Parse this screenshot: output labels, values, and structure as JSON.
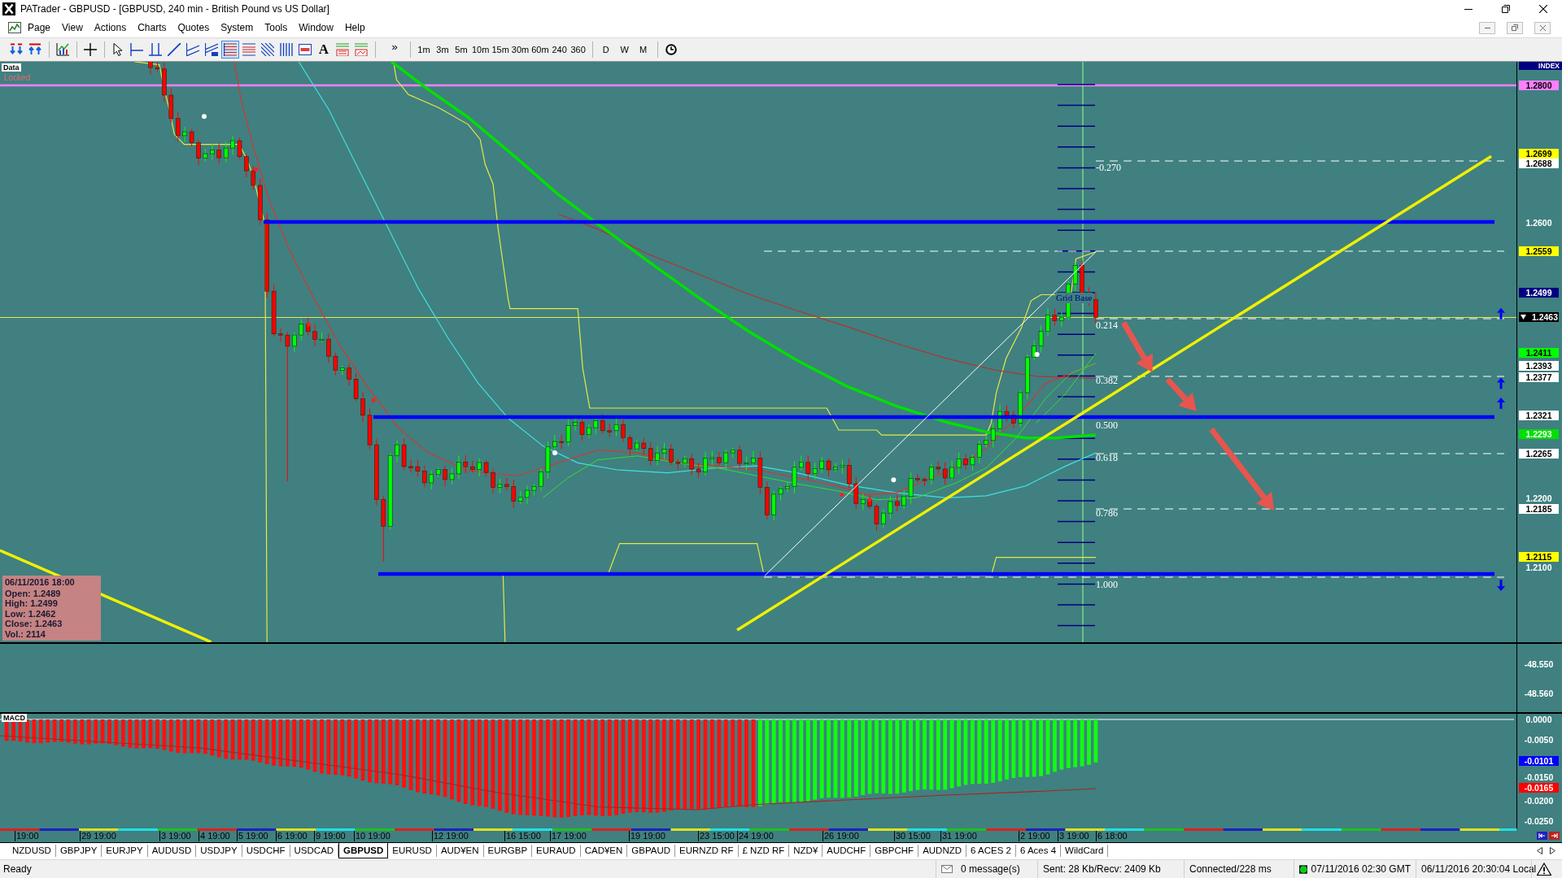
{
  "window": {
    "title": "PATrader - GBPUSD - [GBPUSD, 240 min - British Pound vs US Dollar]"
  },
  "menu": [
    "Page",
    "View",
    "Actions",
    "Charts",
    "Quotes",
    "System",
    "Tools",
    "Window",
    "Help"
  ],
  "toolbar": {
    "tools": [
      {
        "selected": false
      },
      {
        "selected": false
      },
      {
        "selected": false
      },
      {
        "selected": false
      },
      {
        "selected": false
      },
      {
        "selected": false
      },
      {
        "selected": false
      },
      {
        "selected": false
      },
      {
        "selected": false
      },
      {
        "selected": false
      },
      {
        "selected": true
      },
      {
        "selected": false
      },
      {
        "selected": false
      },
      {
        "selected": false
      },
      {
        "selected": false
      },
      {
        "selected": false,
        "label": "A"
      },
      {
        "selected": false
      },
      {
        "selected": false
      }
    ],
    "overflow": "»",
    "timeframes": [
      "1m",
      "3m",
      "5m",
      "10m",
      "15m",
      "30m",
      "60m",
      "240",
      "360"
    ],
    "periods": [
      "D",
      "W",
      "M"
    ]
  },
  "price_pane": {
    "data_tag": "Data",
    "lock_state": "Locked",
    "axis_header": "INDEX",
    "axis_labels": [
      {
        "label": "1.2800",
        "kind": "marker",
        "color": "#ff80ff"
      },
      {
        "label": "1.2699",
        "kind": "marker",
        "color": "#ffff00"
      },
      {
        "label": "1.2688",
        "kind": "marker",
        "color": "#ffffff"
      },
      {
        "label": "1.2600",
        "kind": "tick"
      },
      {
        "label": "1.2559",
        "kind": "marker",
        "color": "#ffff00"
      },
      {
        "label": "1.2499",
        "kind": "marker",
        "color": "#000080"
      },
      {
        "label": "1.2463",
        "kind": "current",
        "color": "#000000"
      },
      {
        "label": "1.2411",
        "kind": "marker",
        "color": "#00ff00"
      },
      {
        "label": "1.2393",
        "kind": "marker",
        "color": "#ffffff"
      },
      {
        "label": "1.2377",
        "kind": "marker",
        "color": "#ffffff"
      },
      {
        "label": "1.2321",
        "kind": "marker",
        "color": "#ffffff"
      },
      {
        "label": "1.2293",
        "kind": "marker",
        "color": "#00e000"
      },
      {
        "label": "1.2265",
        "kind": "marker",
        "color": "#ffffff"
      },
      {
        "label": "1.2200",
        "kind": "tick"
      },
      {
        "label": "1.2185",
        "kind": "marker",
        "color": "#ffffff"
      },
      {
        "label": "1.2115",
        "kind": "marker",
        "color": "#ffff00"
      },
      {
        "label": "1.2100",
        "kind": "tick"
      }
    ],
    "fib_labels": [
      "-0.270",
      "0.214",
      "0.382",
      "0.500",
      "0.618",
      "0.786",
      "1.000"
    ],
    "grid_label": "Grid Base",
    "bar_info": {
      "time": "06/11/2016 18:00",
      "lines": [
        "Open: 1.2489",
        "High: 1.2499",
        "Low: 1.2462",
        "Close: 1.2463",
        "Vol.: 2114"
      ]
    }
  },
  "indicator_pane": {
    "axis_labels": [
      {
        "label": "-48.550",
        "kind": "tick"
      },
      {
        "label": "-48.560",
        "kind": "tick"
      }
    ]
  },
  "macd_pane": {
    "title": "MACD",
    "axis_labels": [
      {
        "label": "0.0000",
        "kind": "tick"
      },
      {
        "label": "-0.0050",
        "kind": "tick"
      },
      {
        "label": "-0.0101",
        "kind": "marker",
        "color": "#0000ff"
      },
      {
        "label": "-0.0150",
        "kind": "tick"
      },
      {
        "label": "-0.0165",
        "kind": "marker",
        "color": "#ff0000"
      },
      {
        "label": "-0.0200",
        "kind": "tick"
      },
      {
        "label": "-0.0250",
        "kind": "tick"
      }
    ]
  },
  "time_axis": {
    "labels": [
      "19:00",
      "29 19:00",
      "3 19:00",
      "4 19:00",
      "5 19:00",
      "6 19:00",
      "9 19:00",
      "10 19:00",
      "12 19:00",
      "16 15:00",
      "17 19:00",
      "19 19:00",
      "23 15:00",
      "24 19:00",
      "26 19:00",
      "30 15:00",
      "31 19:00",
      "2 19:00",
      "3 19:00",
      "6 18:00"
    ]
  },
  "symbol_tabs": [
    {
      "label": "NZDUSD",
      "selected": false
    },
    {
      "label": "GBPJPY",
      "selected": false
    },
    {
      "label": "EURJPY",
      "selected": false
    },
    {
      "label": "AUDUSD",
      "selected": false
    },
    {
      "label": "USDJPY",
      "selected": false
    },
    {
      "label": "USDCHF",
      "selected": false
    },
    {
      "label": "USDCAD",
      "selected": false
    },
    {
      "label": "GBPUSD",
      "selected": true
    },
    {
      "label": "EURUSD",
      "selected": false
    },
    {
      "label": "AUD¥EN",
      "selected": false
    },
    {
      "label": "EURGBP",
      "selected": false
    },
    {
      "label": "EURAUD",
      "selected": false
    },
    {
      "label": "CAD¥EN",
      "selected": false
    },
    {
      "label": "GBPAUD",
      "selected": false
    },
    {
      "label": "EURNZD RF",
      "selected": false
    },
    {
      "label": "£ NZD RF",
      "selected": false
    },
    {
      "label": "NZD¥",
      "selected": false
    },
    {
      "label": "AUDCHF",
      "selected": false
    },
    {
      "label": "GBPCHF",
      "selected": false
    },
    {
      "label": "AUDNZD",
      "selected": false
    },
    {
      "label": "6 ACES 2",
      "selected": false
    },
    {
      "label": "6 Aces 4",
      "selected": false
    },
    {
      "label": "WildCard",
      "selected": false
    }
  ],
  "status_bar": {
    "text": "Ready",
    "messages": "0 message(s)",
    "traffic": "Sent: 28 Kb/Recv: 2409 Kb",
    "connection": "Connected/228 ms",
    "online": true,
    "server_time": "07/11/2016 02:30 GMT",
    "local_time": "06/11/2016 20:30:04 Local"
  }
}
